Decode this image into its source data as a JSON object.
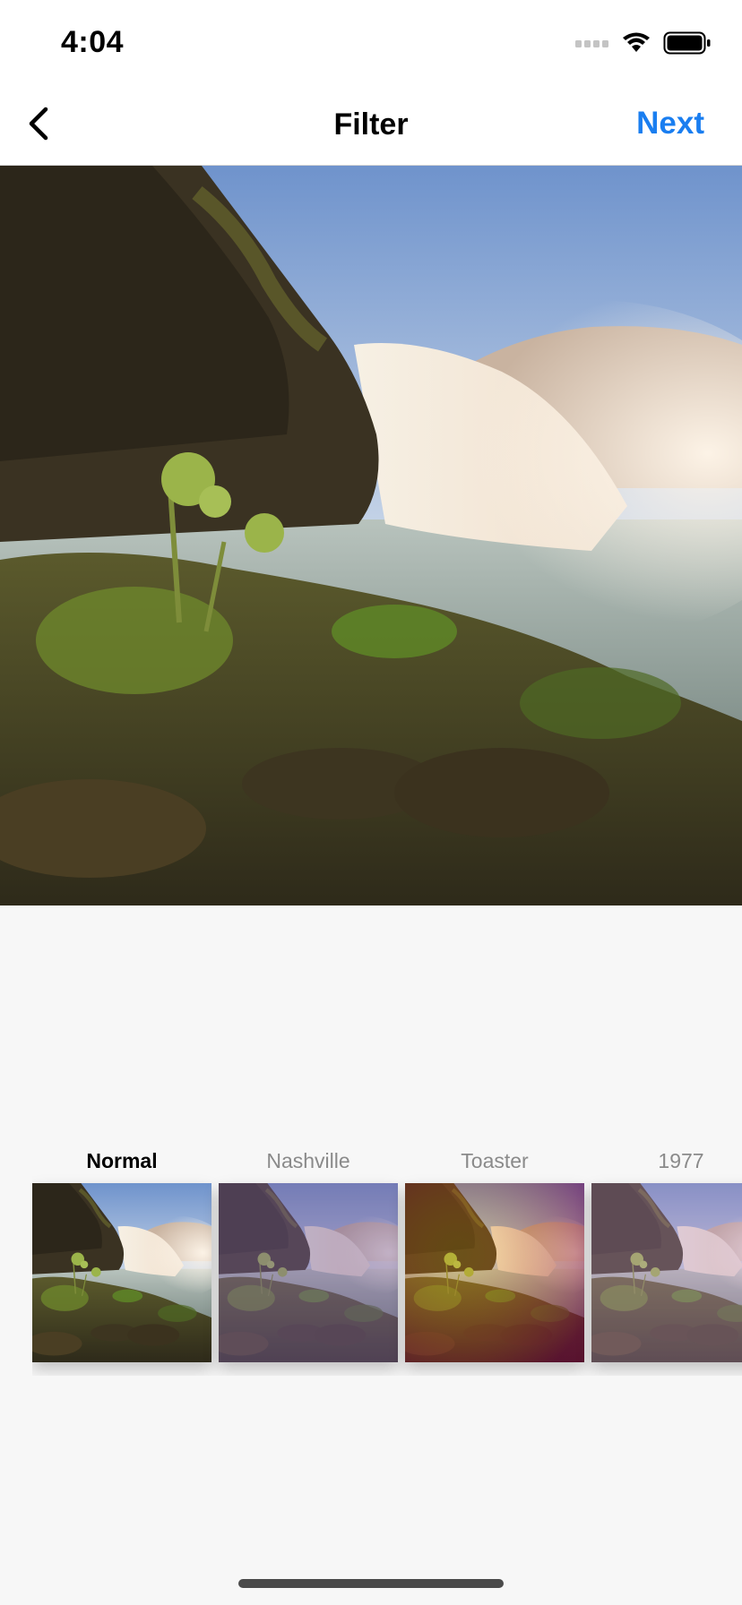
{
  "status_bar": {
    "time": "4:04",
    "icons": [
      "signal-dots-icon",
      "wifi-icon",
      "battery-icon"
    ]
  },
  "nav": {
    "title": "Filter",
    "next_label": "Next",
    "back_icon": "chevron-left-icon",
    "accent_color": "#1a7ef0"
  },
  "photo": {
    "subject": "waterfall-landscape-photo"
  },
  "filters": [
    {
      "label": "Normal",
      "selected": true
    },
    {
      "label": "Nashville",
      "selected": false
    },
    {
      "label": "Toaster",
      "selected": false
    },
    {
      "label": "1977",
      "selected": false
    }
  ]
}
